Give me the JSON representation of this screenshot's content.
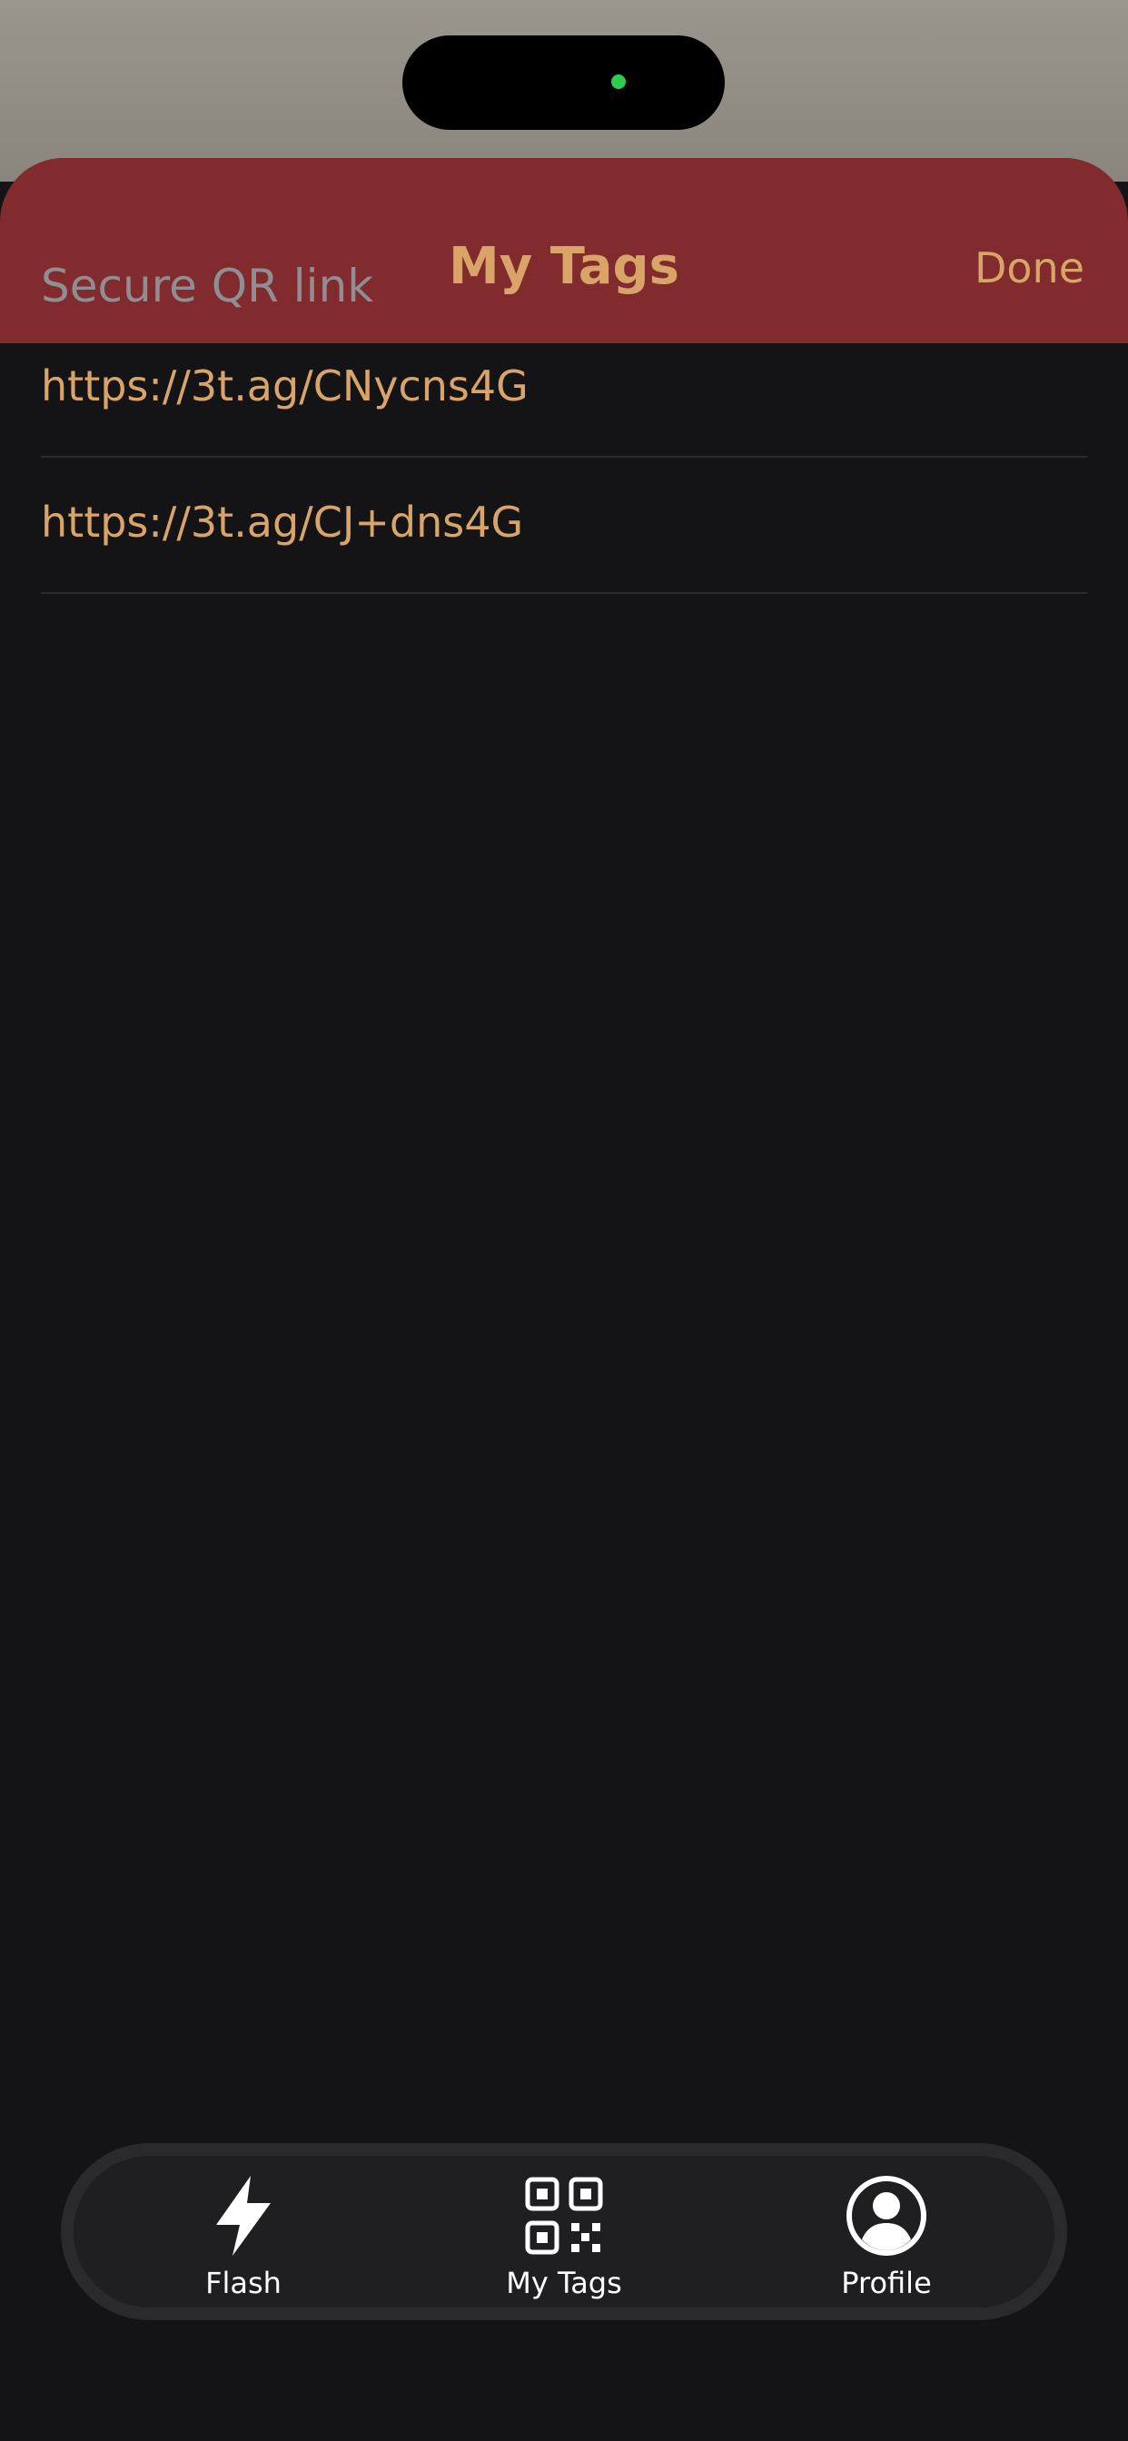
{
  "header": {
    "title": "My Tags",
    "done_label": "Done"
  },
  "section": {
    "header": "Secure QR link"
  },
  "links": [
    {
      "url": "https://3t.ag/CNycns4G"
    },
    {
      "url": "https://3t.ag/CJ+dns4G"
    }
  ],
  "tab_bar": {
    "items": [
      {
        "label": "Flash",
        "icon": "bolt-icon"
      },
      {
        "label": "My Tags",
        "icon": "qr-code-icon"
      },
      {
        "label": "Profile",
        "icon": "profile-icon"
      }
    ]
  },
  "colors": {
    "accent": "#d9a468",
    "header_bg": "#812b2f",
    "background": "#141416",
    "status_indicator": "#2ecc51"
  }
}
